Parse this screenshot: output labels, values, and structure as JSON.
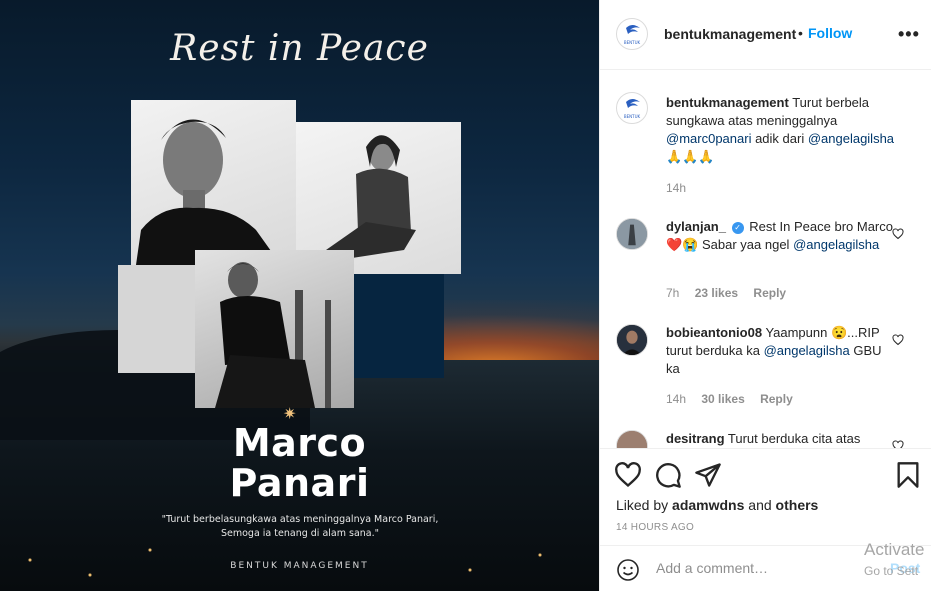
{
  "post_image": {
    "title_script": "Rest in Peace",
    "name_line1": "Marco",
    "name_line2": "Panari",
    "quote": "\"Turut berbelasungkawa atas meninggalnya Marco Panari, Semoga ia tenang di alam sana.\"",
    "brand": "BENTUK MANAGEMENT"
  },
  "header": {
    "username": "bentukmanagement",
    "dot": "•",
    "follow_label": "Follow",
    "more_label": "•••"
  },
  "caption": {
    "username": "bentukmanagement",
    "text_pre": " Turut berbela sungkawa atas meninggalnya ",
    "mention1": "@marc0panari",
    "text_mid": " adik dari ",
    "mention2": "@angelagilsha",
    "emoji": " 🙏🙏🙏",
    "time": "14h"
  },
  "comments": [
    {
      "username": "dylanjan_",
      "verified": "✓",
      "text_pre": " Rest In Peace bro Marco ❤️😭 Sabar yaa ngel ",
      "mention": "@angelagilsha",
      "text_post": "",
      "time": "7h",
      "likes": "23 likes",
      "reply": "Reply"
    },
    {
      "username": "bobieantonio08",
      "text_pre": " Yaampunn 😧...RIP turut berduka ka ",
      "mention": "@angelagilsha",
      "text_post": " GBU ka",
      "time": "14h",
      "likes": "30 likes",
      "reply": "Reply"
    },
    {
      "username": "desitrang",
      "text_pre": " Turut berduka cita atas"
    }
  ],
  "actions": {
    "liked_prefix": "Liked by ",
    "liked_user": "adamwdns",
    "liked_mid": " and ",
    "liked_others": "others",
    "timestamp": "14 HOURS AGO",
    "add_comment_placeholder": "Add a comment…",
    "post_label": "Post"
  },
  "overlay": {
    "activate_line1": "Activate",
    "activate_line2": "Go to Sett"
  },
  "colors": {
    "link_blue": "#0095f6",
    "mention": "#00376b",
    "heart_red": "#ed4956",
    "muted": "#8e8e8e"
  }
}
